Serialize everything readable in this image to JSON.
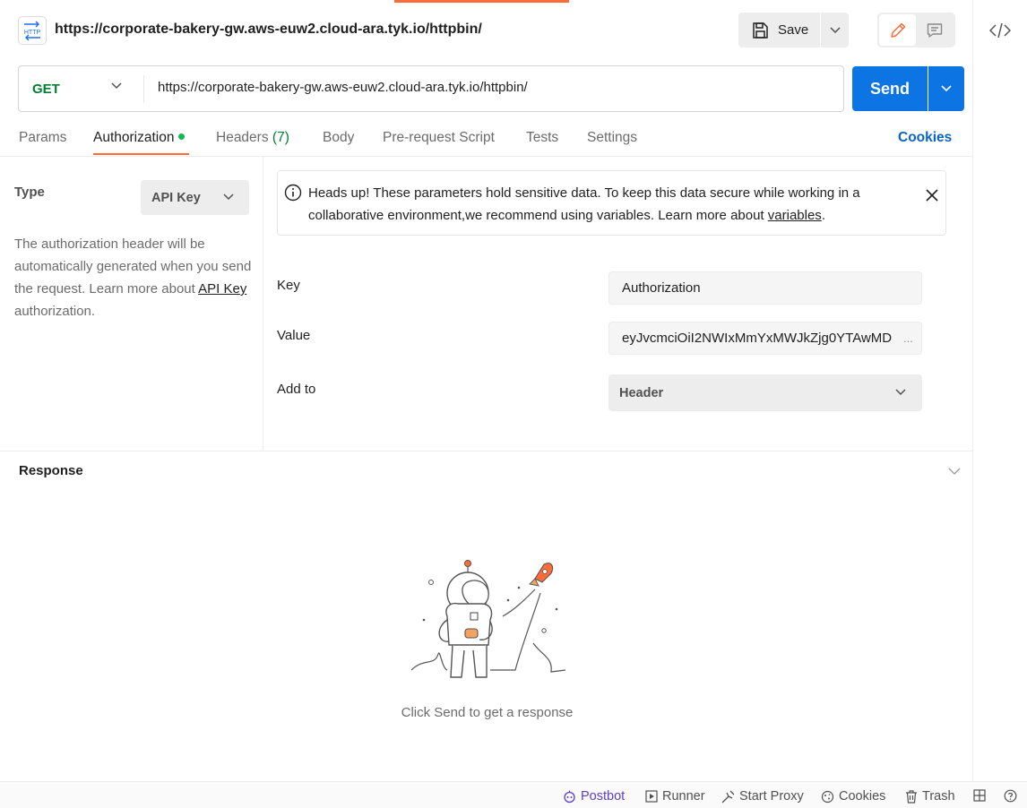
{
  "header": {
    "request_title": "https://corporate-bakery-gw.aws-euw2.cloud-ara.tyk.io/httpbin/",
    "http_icon_label": "HTTP",
    "save_label": "Save"
  },
  "url_bar": {
    "method": "GET",
    "url": "https://corporate-bakery-gw.aws-euw2.cloud-ara.tyk.io/httpbin/",
    "send_label": "Send"
  },
  "tabs": {
    "params": "Params",
    "authorization": "Authorization",
    "headers": "Headers",
    "headers_count": "(7)",
    "body": "Body",
    "pre_request": "Pre-request Script",
    "tests": "Tests",
    "settings": "Settings",
    "cookies": "Cookies"
  },
  "auth": {
    "type_label": "Type",
    "type_value": "API Key",
    "description": "The authorization header will be automatically generated when you send the request. Learn more about",
    "description_link": "API Key",
    "description_suffix": "authorization.",
    "notice_text": "Heads up! These parameters hold sensitive data. To keep this data secure while working in a collaborative environment,we recommend using variables. Learn more about",
    "notice_link": "variables",
    "notice_suffix": ".",
    "key_label": "Key",
    "key_value": "Authorization",
    "value_label": "Value",
    "value_value": "eyJvcmciOiI2NWIxMmYxMWJkZjg0YTAwMD",
    "value_ellipsis": "...",
    "add_to_label": "Add to",
    "add_to_value": "Header"
  },
  "response": {
    "title": "Response",
    "hint": "Click Send to get a response"
  },
  "statusbar": {
    "postbot": "Postbot",
    "runner": "Runner",
    "start_proxy": "Start Proxy",
    "cookies": "Cookies",
    "trash": "Trash"
  },
  "colors": {
    "accent_orange": "#ff6c37",
    "send_blue": "#0d74e4",
    "get_green": "#007f31",
    "link_blue": "#0b63c5",
    "dot_green": "#0cbb52",
    "postbot_purple": "#5b3fc7"
  }
}
